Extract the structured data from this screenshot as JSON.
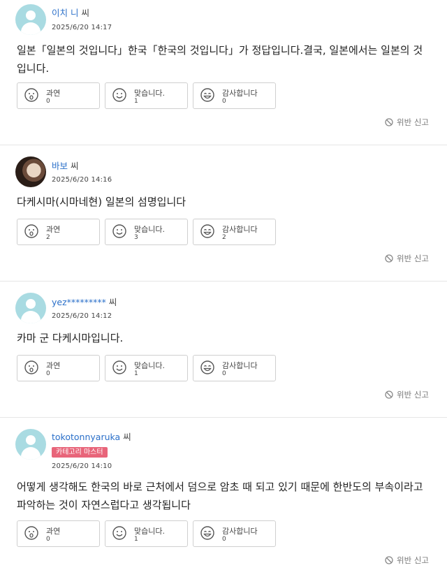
{
  "reaction_labels": {
    "indeed": "과연",
    "agree": "맞습니다.",
    "thanks": "감사합니다"
  },
  "report_label": "위반 신고",
  "answers": [
    {
      "username": "이치 니",
      "suffix": "씨",
      "badge": null,
      "date": "2025/6/20 14:17",
      "text": "일본「일본의 것입니다」한국「한국의 것입니다」가 정답입니다.결국, 일본에서는 일본의 것입니다.",
      "counts": {
        "indeed": "0",
        "agree": "1",
        "thanks": "0"
      }
    },
    {
      "username": "바보",
      "suffix": "씨",
      "badge": null,
      "date": "2025/6/20 14:16",
      "text": "다케시마(시마네현) 일본의 섬명입니다",
      "counts": {
        "indeed": "2",
        "agree": "3",
        "thanks": "2"
      }
    },
    {
      "username": "yez*********",
      "suffix": "씨",
      "badge": null,
      "date": "2025/6/20 14:12",
      "text": "카마 군 다케시마입니다.",
      "counts": {
        "indeed": "0",
        "agree": "1",
        "thanks": "0"
      }
    },
    {
      "username": "tokotonnyaruka",
      "suffix": "씨",
      "badge": "카테고리 마스터",
      "date": "2025/6/20 14:10",
      "text": "어떻게 생각해도 한국의 바로 근처에서 덤으로 암초 때 되고 있기 때문에 한반도의 부속이라고 파악하는 것이 자연스럽다고 생각됩니다",
      "counts": {
        "indeed": "0",
        "agree": "1",
        "thanks": "0"
      }
    }
  ]
}
